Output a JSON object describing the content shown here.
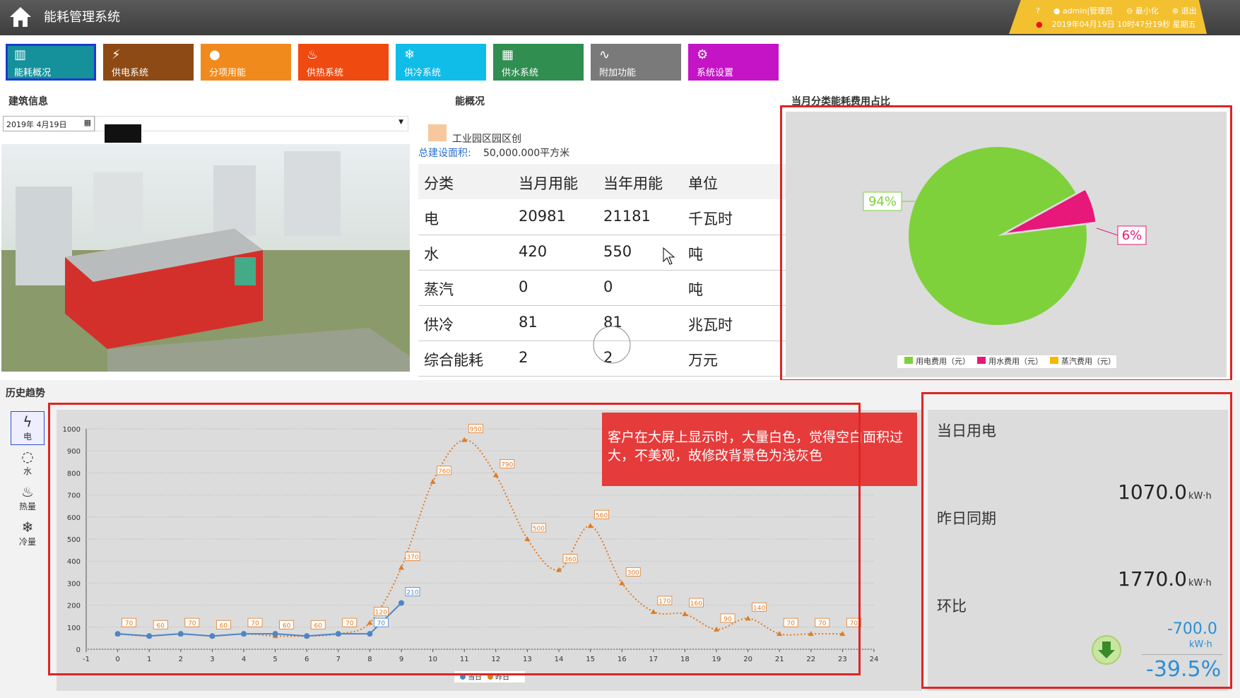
{
  "app": {
    "title": "能耗管理系统"
  },
  "user": {
    "name": "admin|管理员",
    "minimize": "最小化",
    "logout": "退出",
    "datetime": "2019年04月19日 10时47分19秒 星期五"
  },
  "modules": [
    {
      "label": "能耗概况",
      "icon": "chart-icon",
      "color": "#15919c"
    },
    {
      "label": "供电系统",
      "icon": "power-icon",
      "color": "#8e4a14"
    },
    {
      "label": "分项用能",
      "icon": "person-icon",
      "color": "#f08a1c"
    },
    {
      "label": "供热系统",
      "icon": "flame-icon",
      "color": "#ef4a10"
    },
    {
      "label": "供冷系统",
      "icon": "snowflake-icon",
      "color": "#10bde8"
    },
    {
      "label": "供水系统",
      "icon": "grid-icon",
      "color": "#2f8e50"
    },
    {
      "label": "附加功能",
      "icon": "pulse-icon",
      "color": "#7a7a7a"
    },
    {
      "label": "系统设置",
      "icon": "gear-icon",
      "color": "#c414c6"
    }
  ],
  "building": {
    "heading": "建筑信息",
    "date": "2019年  4月19日"
  },
  "overview": {
    "heading": "能概况",
    "park": "工业园区园区创",
    "area_label": "总建设面积:",
    "area_value": "50,000.000平方米"
  },
  "table": {
    "headers": [
      "分类",
      "当月用能",
      "当年用能",
      "单位"
    ],
    "rows": [
      [
        "电",
        "20981",
        "21181",
        "千瓦时"
      ],
      [
        "水",
        "420",
        "550",
        "吨"
      ],
      [
        "蒸汽",
        "0",
        "0",
        "吨"
      ],
      [
        "供冷",
        "81",
        "81",
        "兆瓦时"
      ],
      [
        "综合能耗",
        "2",
        "2",
        "万元"
      ]
    ]
  },
  "pie": {
    "heading": "当月分类能耗费用占比",
    "chart_data": {
      "type": "pie",
      "slices": [
        {
          "name": "用电费用（元）",
          "value": 94,
          "color": "#7ed13b"
        },
        {
          "name": "用水费用（元）",
          "value": 6,
          "color": "#e8177a"
        },
        {
          "name": "蒸汽费用（元）",
          "value": 0,
          "color": "#f5b800"
        }
      ],
      "labels": [
        "94%",
        "6%"
      ],
      "legend_position": "bottom"
    }
  },
  "trend": {
    "heading": "历史趋势",
    "side": [
      {
        "label": "电",
        "icon": "lightning-icon"
      },
      {
        "label": "水",
        "icon": "water-drop-icon"
      },
      {
        "label": "热量",
        "icon": "heat-icon"
      },
      {
        "label": "冷量",
        "icon": "snowflake-icon"
      }
    ],
    "annotation": "客户在大屏上显示时，大量白色，觉得空白面积过大，不美观，故修改背景色为浅灰色",
    "chart_data": {
      "type": "line",
      "x": [
        -1,
        0,
        1,
        2,
        3,
        4,
        5,
        6,
        7,
        8,
        9,
        10,
        11,
        12,
        13,
        14,
        15,
        16,
        17,
        18,
        19,
        20,
        21,
        22,
        23,
        24
      ],
      "ylim": [
        0,
        1000
      ],
      "yticks": [
        0,
        100,
        200,
        300,
        400,
        500,
        600,
        700,
        800,
        900,
        1000
      ],
      "xlim": [
        -1,
        24
      ],
      "series": [
        {
          "name": "当日",
          "color": "#4a86c8",
          "x": [
            0,
            1,
            2,
            3,
            4,
            5,
            6,
            7,
            8,
            9
          ],
          "values": [
            70,
            60,
            70,
            60,
            70,
            70,
            60,
            70,
            70,
            210
          ]
        },
        {
          "name": "昨日",
          "color": "#e07b24",
          "x": [
            0,
            1,
            2,
            3,
            4,
            5,
            6,
            7,
            8,
            9,
            10,
            11,
            12,
            13,
            14,
            15,
            16,
            17,
            18,
            19,
            20,
            21,
            22,
            23
          ],
          "values": [
            70,
            60,
            70,
            60,
            70,
            60,
            60,
            70,
            120,
            370,
            760,
            950,
            790,
            500,
            360,
            560,
            300,
            170,
            160,
            90,
            140,
            70,
            70,
            70
          ]
        }
      ],
      "label_x": [
        0,
        1,
        2,
        3,
        4,
        5,
        6,
        7,
        8,
        8,
        9,
        9,
        10,
        11,
        12,
        13,
        14,
        15,
        16,
        17,
        18,
        19,
        20,
        21,
        22,
        23
      ],
      "label_values": [
        70,
        60,
        70,
        60,
        70,
        60,
        60,
        70,
        70,
        120,
        370,
        210,
        760,
        950,
        790,
        500,
        360,
        560,
        300,
        170,
        160,
        90,
        140,
        70,
        70,
        70
      ],
      "legend_position": "bottom"
    }
  },
  "stats": {
    "today_label": "当日用电",
    "today_value": "1070.0",
    "yesterday_label": "昨日同期",
    "yesterday_value": "1770.0",
    "unit": "kW·h",
    "ratio_label": "环比",
    "diff_value": "-700.0",
    "diff_unit": "kW·h",
    "percent": "-39.5%"
  }
}
